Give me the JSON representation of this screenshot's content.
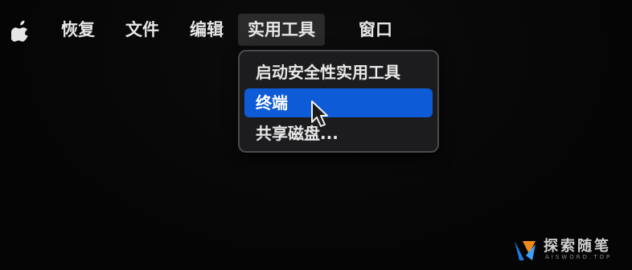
{
  "menubar": {
    "apple_icon": "apple-logo-icon",
    "items": [
      {
        "label": "恢复"
      },
      {
        "label": "文件"
      },
      {
        "label": "编辑"
      },
      {
        "label": "实用工具",
        "active": true
      },
      {
        "label": "窗口"
      }
    ]
  },
  "dropdown": {
    "items": [
      {
        "label": "启动安全性实用工具"
      },
      {
        "label": "终端",
        "selected": true
      },
      {
        "label": "共享磁盘..."
      }
    ]
  },
  "watermark": {
    "text": "探索随笔",
    "subtext": "AISWORD.TOP"
  },
  "colors": {
    "background": "#060606",
    "highlight": "#0d5bd6",
    "menu_text": "#e6e6e6"
  }
}
